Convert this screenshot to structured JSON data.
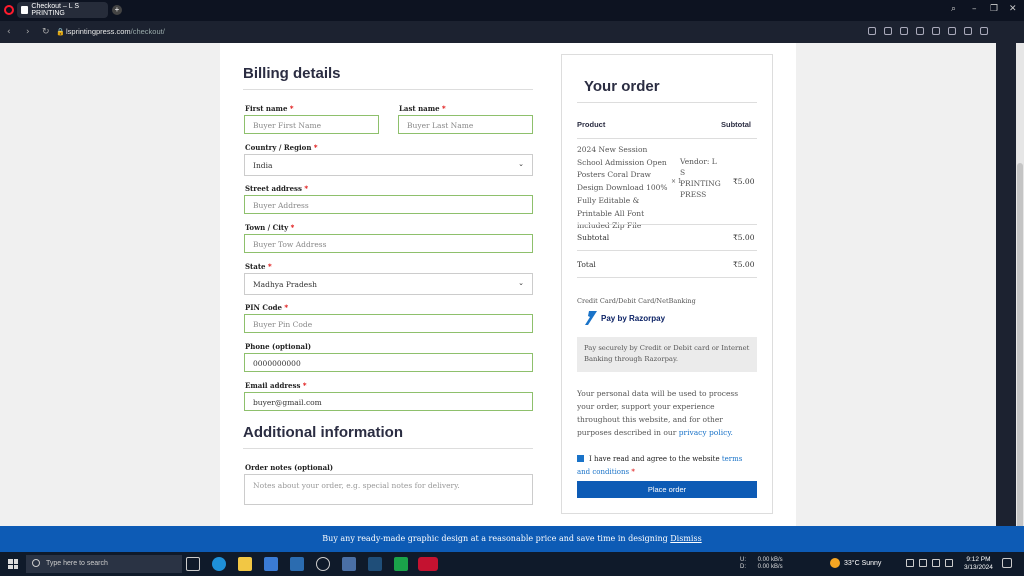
{
  "browser": {
    "tab_title": "Checkout – L S PRINTING",
    "new_tab": "+",
    "url_domain": "lsprintingpress.com",
    "url_path": "/checkout/"
  },
  "billing": {
    "heading": "Billing details",
    "first_name_label": "First name",
    "first_name_placeholder": "Buyer First Name",
    "last_name_label": "Last name",
    "last_name_placeholder": "Buyer Last Name",
    "country_label": "Country / Region",
    "country_value": "India",
    "street_label": "Street address",
    "street_placeholder": "Buyer Address",
    "city_label": "Town / City",
    "city_placeholder": "Buyer Tow Address",
    "state_label": "State",
    "state_value": "Madhya Pradesh",
    "pin_label": "PIN Code",
    "pin_placeholder": "Buyer Pin Code",
    "phone_label": "Phone (optional)",
    "phone_value": "0000000000",
    "email_label": "Email address",
    "email_value": "buyer@gmail.com",
    "required_mark": "*"
  },
  "additional": {
    "heading": "Additional information",
    "notes_label": "Order notes (optional)",
    "notes_placeholder": "Notes about your order, e.g. special notes for delivery."
  },
  "order": {
    "heading": "Your order",
    "col_product": "Product",
    "col_subtotal": "Subtotal",
    "product_name": "2024 New Session School Admission Open Posters Coral Draw Design Download 100% Fully Editable & Printable All Font included Zip File",
    "product_qty": "× 1",
    "vendor": "Vendor: L S PRINTING PRESS",
    "product_price": "₹5.00",
    "subtotal_label": "Subtotal",
    "subtotal_value": "₹5.00",
    "total_label": "Total",
    "total_value": "₹5.00"
  },
  "payment": {
    "method_title": "Credit Card/Debit Card/NetBanking",
    "brand": "Pay by Razorpay",
    "description": "Pay securely by Credit or Debit card or Internet Banking through Razorpay.",
    "privacy_text": "Your personal data will be used to process your order, support your experience throughout this website, and for other purposes described in our",
    "privacy_link": "privacy policy.",
    "terms_text": "I have read and agree to the website",
    "terms_link": "terms and conditions",
    "place_order": "Place order"
  },
  "notice": {
    "text": "Buy any ready-made graphic design at a reasonable price and save time in designing",
    "dismiss": "Dismiss"
  },
  "taskbar": {
    "search_placeholder": "Type here to search",
    "net_up": "U:",
    "net_down": "D:",
    "net_up_value": "0.00 kB/s",
    "net_down_value": "0.00 kB/s",
    "weather": "33°C  Sunny",
    "time": "9:12 PM",
    "date": "3/13/2024"
  }
}
